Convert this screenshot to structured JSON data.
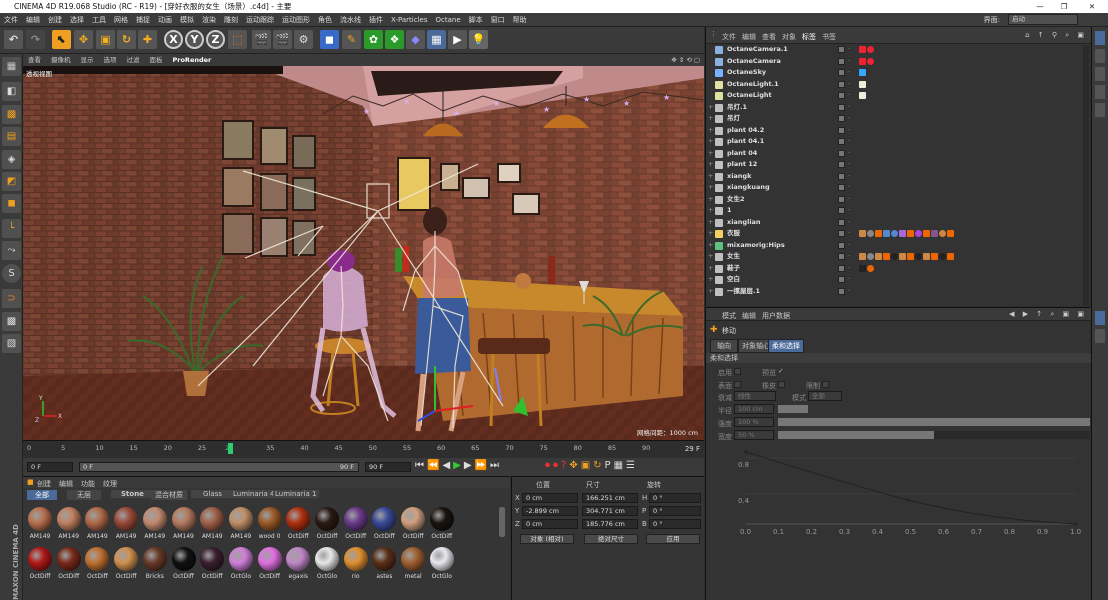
{
  "window": {
    "title": "CINEMA 4D R19.068 Studio (RC - R19) - [穿好衣服的女生（场景）.c4d] - 主要"
  },
  "menu": [
    "文件",
    "编辑",
    "创建",
    "选择",
    "工具",
    "网格",
    "捕捉",
    "动画",
    "模拟",
    "渲染",
    "雕刻",
    "运动跟踪",
    "运动图形",
    "角色",
    "流水线",
    "插件",
    "X-Particles",
    "Octane",
    "脚本",
    "窗口",
    "帮助"
  ],
  "layout": {
    "label": "界面:",
    "value": "启动"
  },
  "viewport": {
    "menu": [
      "查看",
      "摄像机",
      "显示",
      "选项",
      "过滤",
      "面板",
      "ProRender"
    ],
    "label": "透视视图",
    "grid_text": "网格间距：1000 cm"
  },
  "timeline": {
    "ticks": [
      "0",
      "5",
      "10",
      "15",
      "20",
      "25",
      "29",
      "35",
      "40",
      "45",
      "50",
      "55",
      "60",
      "65",
      "70",
      "75",
      "80",
      "85",
      "90"
    ],
    "current": "29",
    "end_frame": "29 F"
  },
  "transport": {
    "start": "0 F",
    "current": "0 F",
    "max": "90 F",
    "end": "90 F"
  },
  "materials": {
    "menu": [
      "创建",
      "编辑",
      "功能",
      "纹理"
    ],
    "tabs": [
      "全部",
      "无层",
      "Stone",
      "混合材质",
      "Glass",
      "Luminaria 4",
      "Luminaria 1"
    ],
    "row1": [
      "AM149",
      "AM149",
      "AM149",
      "AM149",
      "AM149",
      "AM149",
      "AM149",
      "AM149",
      "wood 0",
      "OctDiff",
      "OctDiff",
      "OctDiff",
      "OctDiff",
      "OctDiff",
      "OctDiff"
    ],
    "row2": [
      "OctDiff",
      "OctDiff",
      "OctDiff",
      "OctDiff",
      "Bricks",
      "OctDiff",
      "OctDiff",
      "OctGlo",
      "OctDiff",
      "egaxis",
      "OctGlo",
      "rio",
      "astes",
      "metal",
      "OctGlo"
    ],
    "row1_colors": [
      "#b77050",
      "#c08060",
      "#b06a48",
      "#9a4a3a",
      "#c28a70",
      "#b57a60",
      "#a06048",
      "#c09068",
      "#9a5a28",
      "#b03010",
      "#2a1a14",
      "#6a3a8a",
      "#3a4a9a",
      "#d0a080",
      "#1a1410"
    ],
    "row2_colors": [
      "#b01818",
      "#7a2a1a",
      "#c07030",
      "#d09050",
      "#6a3a28",
      "#111111",
      "#3a2030",
      "#d080d8",
      "#e070e0",
      "#c088c8",
      "#e8e8e8",
      "#e09030",
      "#5a3018",
      "#a06030",
      "#e8e8f0"
    ],
    "brand": "MAXON CINEMA 4D"
  },
  "coords": {
    "headers": [
      "位置",
      "尺寸",
      "旋转"
    ],
    "rows": [
      {
        "axis": "X",
        "pos": "0 cm",
        "size": "166.251 cm",
        "rot_axis": "H",
        "rot": "0 °"
      },
      {
        "axis": "Y",
        "pos": "-2.899 cm",
        "size": "304.771 cm",
        "rot_axis": "P",
        "rot": "0 °"
      },
      {
        "axis": "Z",
        "pos": "0 cm",
        "size": "185.776 cm",
        "rot_axis": "B",
        "rot": "0 °"
      }
    ],
    "mode": "对象 (相对)",
    "size_mode": "绝对尺寸",
    "apply": "应用"
  },
  "objects": {
    "menu": [
      "文件",
      "编辑",
      "查看",
      "对象",
      "标签",
      "书签"
    ],
    "items": [
      {
        "name": "OctaneCamera.1",
        "color": "#8ab0e0"
      },
      {
        "name": "OctaneCamera",
        "color": "#8ab0e0"
      },
      {
        "name": "OctaneSky",
        "color": "#7ab0ff"
      },
      {
        "name": "OctaneLight.1",
        "color": "#e0e0a0"
      },
      {
        "name": "OctaneLight",
        "color": "#e0e0a0"
      },
      {
        "name": "吊灯.1",
        "color": "#c0c0c0"
      },
      {
        "name": "吊灯",
        "color": "#c0c0c0"
      },
      {
        "name": "plant 04.2",
        "color": "#c0c0c0"
      },
      {
        "name": "plant 04.1",
        "color": "#c0c0c0"
      },
      {
        "name": "plant 04",
        "color": "#c0c0c0"
      },
      {
        "name": "plant 12",
        "color": "#c0c0c0"
      },
      {
        "name": "xiangk",
        "color": "#c0c0c0"
      },
      {
        "name": "xiangkuang",
        "color": "#c0c0c0"
      },
      {
        "name": "女生2",
        "color": "#c0c0c0"
      },
      {
        "name": "1",
        "color": "#c0c0c0"
      },
      {
        "name": "xianglian",
        "color": "#c0c0c0"
      },
      {
        "name": "衣服",
        "color": "#f0d060"
      },
      {
        "name": "mixamorig:Hips",
        "color": "#60c080"
      },
      {
        "name": "女生",
        "color": "#c0c0c0"
      },
      {
        "name": "鞋子",
        "color": "#c0c0c0"
      },
      {
        "name": "空白",
        "color": "#c0c0c0"
      },
      {
        "name": "一摞屋层.1",
        "color": "#c0c0c0"
      }
    ]
  },
  "attributes": {
    "menu": [
      "模式",
      "编辑",
      "用户数据"
    ],
    "title": "移动",
    "tabs": [
      "轴向",
      "对象轴心",
      "柔和选择"
    ],
    "section": "柔和选择",
    "enable_label": "启用",
    "preview_label": "预览",
    "surface_label": "表面",
    "rubber_label": "橡皮",
    "restrict_label": "限制",
    "falloff_label": "衰减",
    "falloff_value": "线性",
    "mode_label": "模式",
    "mode_value": "全部",
    "radius_label": "半径",
    "radius_value": "100 cm",
    "strength_label": "强度",
    "strength_value": "100 %",
    "width_label": "宽度",
    "width_value": "50 %",
    "strength": 1.0,
    "width": 0.5,
    "graph_y": [
      "0.8",
      "0.4"
    ],
    "graph_x": [
      "0.0",
      "0.1",
      "0.2",
      "0.3",
      "0.4",
      "0.5",
      "0.6",
      "0.7",
      "0.8",
      "0.9",
      "1.0"
    ]
  },
  "colors": {
    "accent": "#e8a030",
    "active_tab": "#4a6a9a",
    "timeline_marker": "#2ecc71"
  }
}
